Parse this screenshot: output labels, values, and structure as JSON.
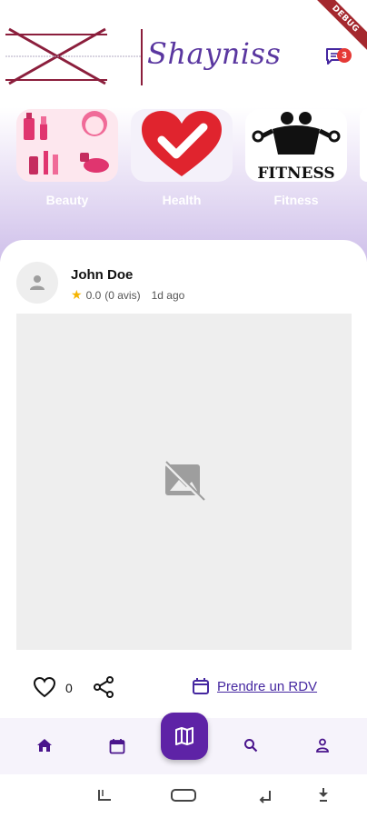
{
  "status": {
    "debug_label": "DEBUG"
  },
  "header": {
    "logo_text": "Shayniss",
    "chat_badge_count": "3",
    "chat_icon": "chat-icon"
  },
  "categories": [
    {
      "label": "Beauty",
      "icon": "cosmetics-image"
    },
    {
      "label": "Health",
      "icon": "heart-check-image"
    },
    {
      "label": "Fitness",
      "icon": "fitness-image",
      "image_text": "FITNESS"
    }
  ],
  "post": {
    "author": "John Doe",
    "rating": "0.0",
    "reviews": "(0 avis)",
    "time": "1d ago",
    "likes": "0",
    "cta_label": "Prendre un RDV"
  },
  "bottom_nav": {
    "items": [
      "home-icon",
      "calendar-icon",
      "map-icon",
      "search-icon",
      "person-icon"
    ]
  },
  "colors": {
    "accent": "#5e23a6",
    "link": "#4527a0",
    "badge": "#e53935",
    "heart": "#e0242e"
  }
}
